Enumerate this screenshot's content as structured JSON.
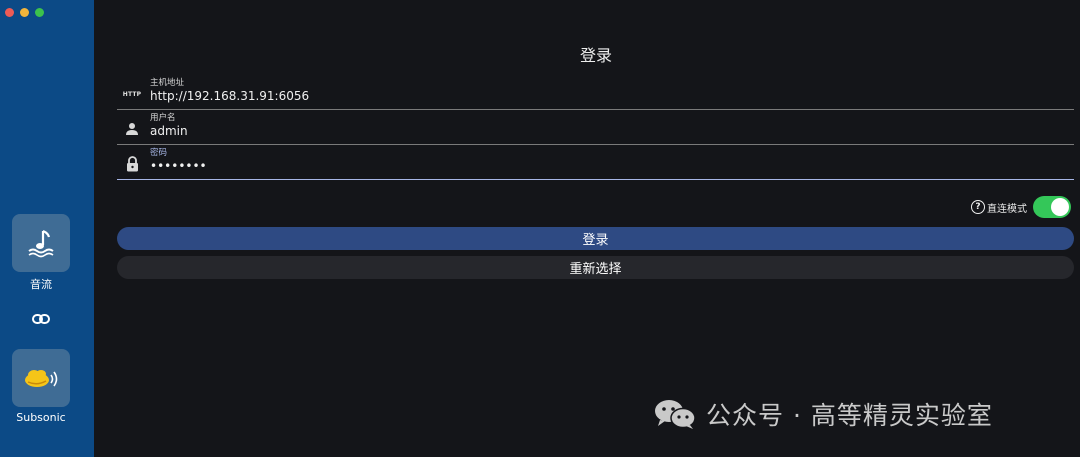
{
  "window": {
    "controls": [
      "close",
      "minimize",
      "zoom"
    ]
  },
  "sidebar": {
    "apps": [
      {
        "label": "音流",
        "icon": "music-wave-icon"
      },
      {
        "label": "Subsonic",
        "icon": "subsonic-cloud-icon"
      }
    ],
    "link_icon": "link-icon"
  },
  "form": {
    "title": "登录",
    "host": {
      "label": "主机地址",
      "value": "http://192.168.31.91:6056",
      "badge": "HTTP"
    },
    "username": {
      "label": "用户名",
      "value": "admin"
    },
    "password": {
      "label": "密码",
      "value": "••••••••"
    },
    "direct_mode": {
      "label": "直连模式",
      "enabled": true
    },
    "login_button": "登录",
    "reselect_button": "重新选择"
  },
  "watermark": {
    "text": "公众号 · 高等精灵实验室"
  },
  "colors": {
    "sidebar": "#0c4a86",
    "background": "#141519",
    "primary_button": "#2e4a83",
    "toggle_on": "#34c759",
    "active_underline": "#a7b6e6"
  }
}
